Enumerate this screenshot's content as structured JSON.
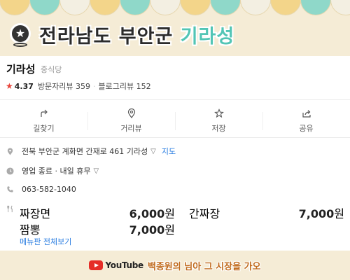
{
  "banner": {
    "title_main": "전라남도 부안군 ",
    "title_highlight": "기라성",
    "scallop_colors": [
      "#f3d58a",
      "#8fd8c9",
      "#f3efe2",
      "#f3d58a",
      "#8fd8c9",
      "#f3efe2",
      "#f3d58a",
      "#8fd8c9",
      "#f3efe2",
      "#f3d58a",
      "#8fd8c9",
      "#f3efe2",
      "#f3d58a"
    ]
  },
  "place": {
    "name": "기라성",
    "category": "중식당",
    "rating": "4.37",
    "visitor_reviews": "방문자리뷰 359",
    "blog_reviews": "블로그리뷰 152"
  },
  "actions": [
    {
      "label": "길찾기",
      "icon": "directions-icon"
    },
    {
      "label": "거리뷰",
      "icon": "location-pin-icon"
    },
    {
      "label": "저장",
      "icon": "star-icon"
    },
    {
      "label": "공유",
      "icon": "share-icon"
    }
  ],
  "info": {
    "address": "전북 부안군 계화면 간재로 461 기라성",
    "map_link": "지도",
    "status": "영업 종료 · 내일 휴무",
    "phone": "063-582-1040"
  },
  "menu": {
    "items": [
      {
        "name": "짜장면",
        "price": "6,000",
        "unit": "원"
      },
      {
        "name": "간짜장",
        "price": "7,000",
        "unit": "원"
      },
      {
        "name": "짬뽕",
        "price": "7,000",
        "unit": "원"
      }
    ],
    "more_link": "메뉴판 전체보기"
  },
  "footer": {
    "platform": "YouTube",
    "channel": "백종원의 님아 그 시장을 가오"
  },
  "colors": {
    "background": "#f5ecd6",
    "accent_teal": "#52c5b5",
    "link_blue": "#2a7de1",
    "rating_star": "#e8443a",
    "youtube_red": "#e52d27"
  }
}
